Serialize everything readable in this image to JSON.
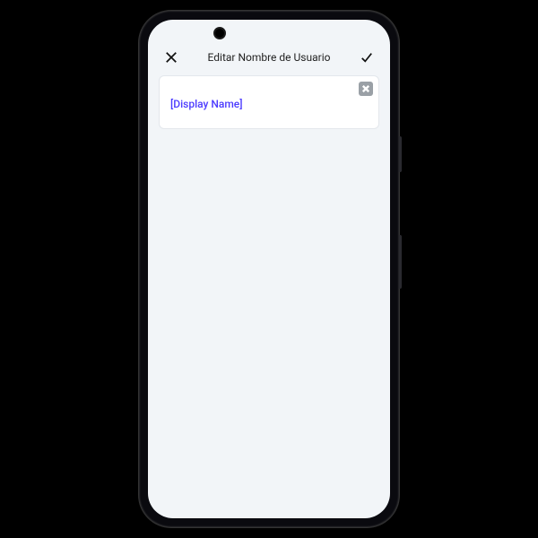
{
  "header": {
    "title": "Editar Nombre de Usuario"
  },
  "input": {
    "value": "[Display Name]"
  },
  "colors": {
    "accent": "#4b3aff"
  }
}
